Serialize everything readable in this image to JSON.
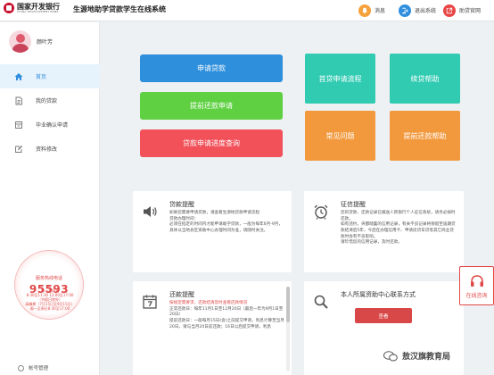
{
  "header": {
    "bank_name_cn": "国家开发银行",
    "bank_name_en": "CHINA DEVELOPMENT BANK",
    "system_title": "生源地助学贷款学生在线系统",
    "message_label": "消息",
    "exit_label": "退出系统",
    "site_label": "助贷官网"
  },
  "user": {
    "name": "颜叶芳"
  },
  "sidebar": {
    "items": [
      {
        "label": "首页",
        "icon": "home-icon",
        "active": true
      },
      {
        "label": "我的贷款",
        "icon": "document-icon",
        "active": false
      },
      {
        "label": "毕业确认申请",
        "icon": "graduation-icon",
        "active": false
      },
      {
        "label": "资料修改",
        "icon": "edit-icon",
        "active": false
      }
    ],
    "hotline_label": "服务热线电话",
    "hotline_number": "95593",
    "hours": [
      "周一至周五",
      "8:30至11:30 13:00至17:00",
      "（节假日除外）",
      "高峰期（7月15日至9月15日）",
      "周一至周日8:30至17:00"
    ],
    "account_label": "帐号管理"
  },
  "actions": {
    "apply_loan": "申请贷款",
    "early_repay": "提前还款申请",
    "progress_query": "贷款申请进度查询"
  },
  "tiles": {
    "first_process": "首贷申请流程",
    "renew_help": "续贷帮助",
    "faq": "常见问题",
    "early_help": "提前还款帮助"
  },
  "panels": {
    "loan_notice": {
      "title": "贷款提醒",
      "lines": [
        "如果您需要申请贷款，请查看生源地贷款申请流程",
        "贷款办理时间：",
        "必须在指定的时间内才能申请助学贷款，一般为每年6月-9月，具体以当地县区资助中心办理时间为准，请随时关注。"
      ]
    },
    "credit_notice": {
      "title": "征信提醒",
      "lines": [
        "您的贷款、还款记录已报送人民银行个人征信系统，请务必按时还款。",
        "如有违约，央都储蓄的信用记录，有关不良记录将保留至逾期贷款结清后5年，今后在办理信用卡、申请房贷车贷等其它商业贷款时会有不良影响。",
        "请珍惜您的信用记录，及时还款。"
      ]
    },
    "repay_notice": {
      "title": "还款提醒",
      "warning": "按规定需要求，还款结清及时查看还款情况",
      "lines": [
        "正常还款日：每年11月1日至12月20日（最后一年为9月1日至20日）",
        "提前还款日：一般每月15日(含)之前提交申请，利息计算至当月20日，请与当月20日前还款；16日以后提交申请，利息"
      ]
    },
    "contact": {
      "title": "本人所属资助中心联系方式",
      "button": "查看"
    }
  },
  "consult": {
    "label": "在线咨询"
  },
  "watermark": {
    "text": "敖汉旗教育局"
  },
  "colors": {
    "blue": "#2e8fdc",
    "green": "#5ed042",
    "red": "#f2515a",
    "teal": "#31cbb2",
    "orange": "#f2993e"
  }
}
